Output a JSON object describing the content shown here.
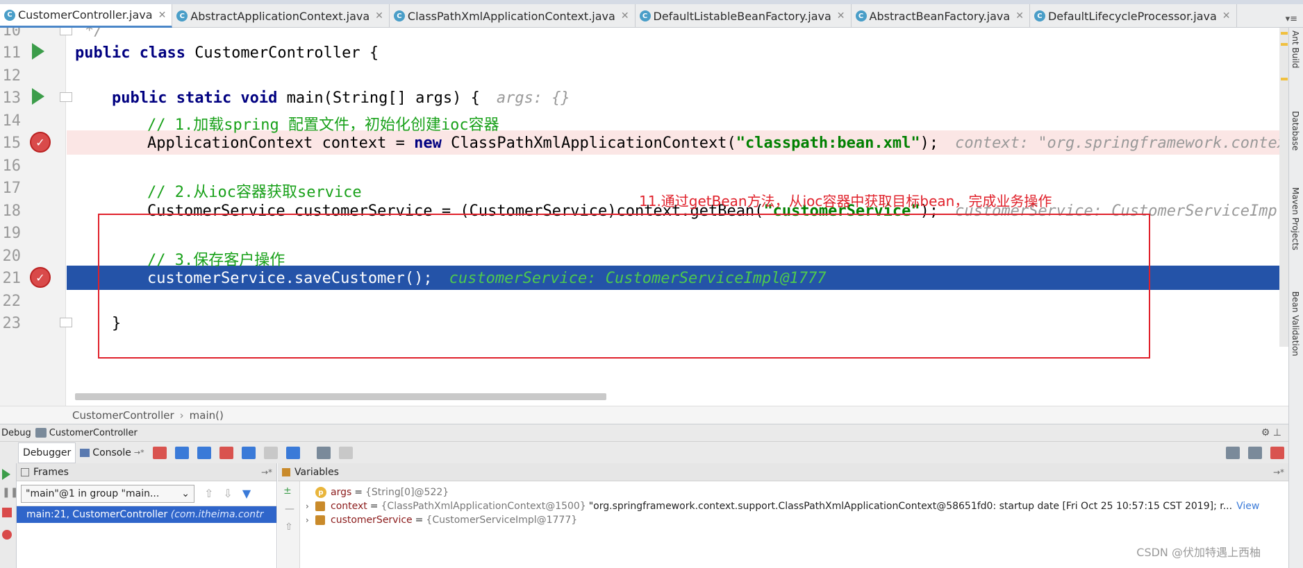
{
  "tabs": [
    {
      "label": "CustomerController.java",
      "active": true
    },
    {
      "label": "AbstractApplicationContext.java",
      "active": false
    },
    {
      "label": "ClassPathXmlApplicationContext.java",
      "active": false
    },
    {
      "label": "DefaultListableBeanFactory.java",
      "active": false
    },
    {
      "label": "AbstractBeanFactory.java",
      "active": false
    },
    {
      "label": "DefaultLifecycleProcessor.java",
      "active": false
    }
  ],
  "editor": {
    "line_numbers": [
      "10",
      "11",
      "12",
      "13",
      "14",
      "15",
      "16",
      "17",
      "18",
      "19",
      "20",
      "21",
      "22",
      "23"
    ],
    "lines": {
      "l10": "*/",
      "l11_kw": "public class ",
      "l11_rest": "CustomerController {",
      "l13_kw": "public static void ",
      "l13_rest": "main(String[] args) {",
      "l13_hint": "args: {}",
      "l14": "// 1.加载spring 配置文件，初始化创建ioc容器",
      "l15_a": "ApplicationContext context = ",
      "l15_kw": "new ",
      "l15_b": "ClassPathXmlApplicationContext(",
      "l15_str": "\"classpath:bean.xml\"",
      "l15_c": ");",
      "l15_hint": "context: \"org.springframework.context",
      "l17": "// 2.从ioc容器获取service",
      "l18_a": "CustomerService customerService = (CustomerService)context.getBean(",
      "l18_str": "\"customerService\"",
      "l18_c": ");",
      "l18_hint": "customerService: CustomerServiceImpl@",
      "l20": "// 3.保存客户操作",
      "l21": "customerService.saveCustomer();",
      "l21_hint": "customerService: CustomerServiceImpl@1777",
      "l23": "}"
    },
    "annotation": "11.通过getBean方法，从ioc容器中获取目标bean，完成业务操作"
  },
  "breadcrumb": [
    "CustomerController",
    "main()"
  ],
  "right_tool_windows": [
    "Ant Build",
    "Database",
    "Maven Projects",
    "Bean Validation"
  ],
  "debug": {
    "title": "Debug",
    "config": "CustomerController",
    "tabs": [
      "Debugger",
      "Console"
    ],
    "frames_title": "Frames",
    "variables_title": "Variables",
    "thread": "\"main\"@1 in group \"main...",
    "frame": "main:21, CustomerController",
    "frame_package": "(com.itheima.contr",
    "variables": [
      {
        "name": "args",
        "type": "{String[0]@522}",
        "value": "",
        "expandable": false
      },
      {
        "name": "context",
        "type": "{ClassPathXmlApplicationContext@1500}",
        "value": "\"org.springframework.context.support.ClassPathXmlApplicationContext@58651fd0: startup date [Fri Oct 25 10:57:15 CST 2019]; r...",
        "expandable": true,
        "link": "View"
      },
      {
        "name": "customerService",
        "type": "{CustomerServiceImpl@1777}",
        "value": "",
        "expandable": true
      }
    ]
  },
  "watermark": "CSDN @伏加特遇上西柚"
}
